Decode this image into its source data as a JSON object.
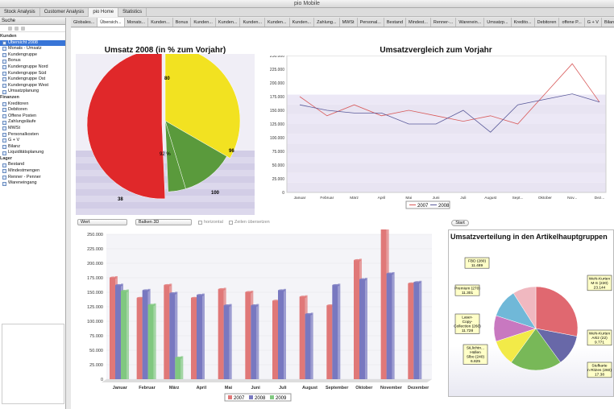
{
  "window": {
    "title": "pio Mobile"
  },
  "perspectives": [
    "Stock Analysis",
    "Customer Analysis",
    "pio Home",
    "Statistics"
  ],
  "left_panel": {
    "header": "Suche",
    "tree": [
      {
        "group": "Kunden",
        "items": [
          "Übersicht 2008",
          "Monats - Umsatz",
          "Kundengruppe",
          "Bonus",
          "Kundengruppe Nord",
          "Kundengruppe Süd",
          "Kundengruppe Ost",
          "Kundengruppe West",
          "Umsatzplanung"
        ]
      },
      {
        "group": "Finanzen",
        "items": [
          "Kreditoren",
          "Debitoren",
          "Offene Posten",
          "Zahlungsläufe",
          "MWSt",
          "Personalkosten",
          "G + V",
          "Bilanz",
          "Liquiditätsplanung"
        ]
      },
      {
        "group": "Lager",
        "items": [
          "Bestand",
          "Mindestmengen",
          "Renner - Penner",
          "Wareneingang"
        ]
      }
    ],
    "selected": "Übersicht 2008"
  },
  "editor_tabs": [
    "Globales...",
    "Übersich...",
    "Monats...",
    "Kunden...",
    "Bonus",
    "Kunden...",
    "Kunden...",
    "Kunden...",
    "Kunden...",
    "Kunden...",
    "Zahlung...",
    "MWSt",
    "Personal...",
    "Bestand",
    "Mindest...",
    "Renner-...",
    "Warenein...",
    "Umsatzp...",
    "Kredito...",
    "Debitoren",
    "offene P...",
    "G + V",
    "Bilanz",
    "Liquiditä..."
  ],
  "active_tab": "Übersich...",
  "controls": {
    "select1": "Wert",
    "select2": "Balken 3D",
    "check1": "horizontal",
    "check2": "Zeilen übersetzen",
    "start_button": "Start"
  },
  "colors": {
    "red": "#e0282a",
    "yellow": "#f2e221",
    "green": "#5a9a3c",
    "line2007": "#d85a5a",
    "line2008": "#5a5a9a"
  },
  "chart_data": [
    {
      "type": "pie",
      "title": "Umsatz 2008 (in % zum Vorjahr)",
      "slices": [
        {
          "label": "80",
          "value": 25,
          "color": "#f2e221"
        },
        {
          "label": "96",
          "value": 9,
          "color": "#5a9a3c"
        },
        {
          "label": "100",
          "value": 3,
          "color": "#5a9a3c"
        },
        {
          "label": "38",
          "value": 38,
          "color": "#e0282a"
        }
      ],
      "extra_label": "92 %"
    },
    {
      "type": "line",
      "title": "Umsatzvergleich zum Vorjahr",
      "categories": [
        "Januar",
        "Februar",
        "März",
        "April",
        "Mai",
        "Juni",
        "Juli",
        "August",
        "Sept...",
        "Oktober",
        "Nov...",
        "Dez..."
      ],
      "ylim": [
        0,
        250000
      ],
      "yticks": [
        "0",
        "25.000",
        "50.000",
        "75.000",
        "100.000",
        "125.000",
        "150.000",
        "175.000",
        "200.000",
        "225.000",
        "250.000"
      ],
      "series": [
        {
          "name": "2007",
          "color": "#d85a5a",
          "values": [
            175000,
            140000,
            160000,
            140000,
            150000,
            140000,
            130000,
            140000,
            125000,
            180000,
            235000,
            165000
          ]
        },
        {
          "name": "2008",
          "color": "#5a5a9a",
          "values": [
            160000,
            150000,
            145000,
            145000,
            125000,
            125000,
            150000,
            110000,
            160000,
            170000,
            180000,
            165000
          ]
        }
      ]
    },
    {
      "type": "bar",
      "categories": [
        "Januar",
        "Februar",
        "März",
        "April",
        "Mai",
        "Juni",
        "Juli",
        "August",
        "September",
        "Oktober",
        "November",
        "Dezember"
      ],
      "ylim": [
        0,
        250000
      ],
      "yticks": [
        "0",
        "25.000",
        "50.000",
        "75.000",
        "100.000",
        "125.000",
        "150.000",
        "175.000",
        "200.000",
        "225.000",
        "250.000"
      ],
      "series": [
        {
          "name": "2007",
          "color": "#e07878",
          "values": [
            175000,
            140000,
            162000,
            140000,
            155000,
            150000,
            135000,
            142000,
            127000,
            205000,
            260000,
            165000
          ]
        },
        {
          "name": "2008",
          "color": "#7878c0",
          "values": [
            162000,
            153000,
            148000,
            145000,
            127000,
            127000,
            153000,
            112000,
            162000,
            172000,
            182000,
            167000
          ]
        },
        {
          "name": "2009",
          "color": "#80c880",
          "values": [
            152000,
            128000,
            37000,
            0,
            0,
            0,
            0,
            0,
            0,
            0,
            0,
            0
          ]
        }
      ]
    },
    {
      "type": "pie",
      "title": "Umsatzverteilung in den Artikelhauptgruppen",
      "slices": [
        {
          "label": "WeN-Kurten\nM-S (220)\n23.144",
          "value": 28,
          "color": "#e06870"
        },
        {
          "label": "WeN-Kurten\nArtiz (22)\n9.771",
          "value": 12,
          "color": "#6868a8"
        },
        {
          "label": "Stufkarte\nn Ritzes (260)\n17.38",
          "value": 20,
          "color": "#78b858"
        },
        {
          "label": "SiLlichtn...\nHüllen\nSlbo (240)\n6.825",
          "value": 10,
          "color": "#f2ea48"
        },
        {
          "label": "Laser-\nCopy-\nCollection (260)\n11.728",
          "value": 10,
          "color": "#c878c0"
        },
        {
          "label": "Premium (270)\n11.301",
          "value": 11,
          "color": "#70b8d8"
        },
        {
          "label": "FBD (280)\n11.489",
          "value": 9,
          "color": "#f0b8c0"
        }
      ]
    }
  ]
}
